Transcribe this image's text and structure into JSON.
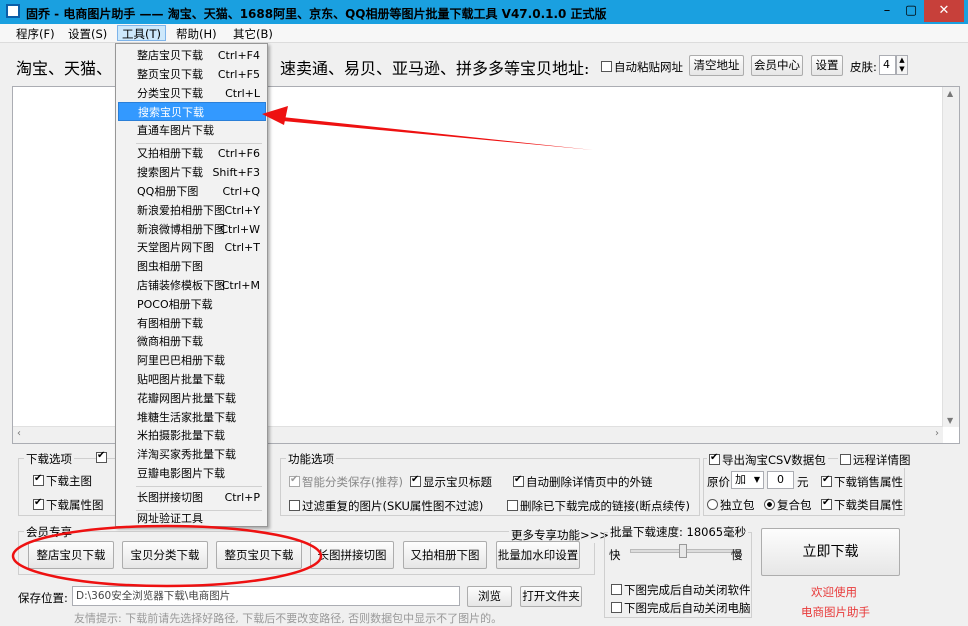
{
  "window": {
    "title": "固乔 - 电商图片助手 —— 淘宝、天猫、1688阿里、京东、QQ相册等图片批量下载工具 V47.0.1.0 正式版",
    "minimize": "–",
    "maximize": "▢",
    "close": "✕"
  },
  "menu": [
    "程序(F)",
    "设置(S)",
    "工具(T)",
    "帮助(H)",
    "其它(B)"
  ],
  "address": {
    "label_left": "淘宝、天猫、",
    "label_right": "速卖通、易贝、亚马逊、拼多多等宝贝地址:",
    "auto_paste": "自动粘贴网址",
    "clear": "清空地址",
    "member_center": "会员中心",
    "settings": "设置",
    "skin_label": "皮肤:",
    "skin_value": "4"
  },
  "dropdown": [
    {
      "label": "整店宝贝下载",
      "shortcut": "Ctrl+F4"
    },
    {
      "label": "整页宝贝下载",
      "shortcut": "Ctrl+F5"
    },
    {
      "label": "分类宝贝下载",
      "shortcut": "Ctrl+L"
    },
    {
      "label": "搜索宝贝下载",
      "shortcut": ""
    },
    {
      "label": "直通车图片下载",
      "shortcut": ""
    },
    {
      "label": "又拍相册下载",
      "shortcut": "Ctrl+F6"
    },
    {
      "label": "搜索图片下载",
      "shortcut": "Shift+F3"
    },
    {
      "label": "QQ相册下图",
      "shortcut": "Ctrl+Q"
    },
    {
      "label": "新浪爱拍相册下图",
      "shortcut": "Ctrl+Y"
    },
    {
      "label": "新浪微博相册下图",
      "shortcut": "Ctrl+W"
    },
    {
      "label": "天堂图片网下图",
      "shortcut": "Ctrl+T"
    },
    {
      "label": "图虫相册下图",
      "shortcut": ""
    },
    {
      "label": "店铺装修模板下图",
      "shortcut": "Ctrl+M"
    },
    {
      "label": "POCO相册下载",
      "shortcut": ""
    },
    {
      "label": "有图相册下载",
      "shortcut": ""
    },
    {
      "label": "微商相册下载",
      "shortcut": ""
    },
    {
      "label": "阿里巴巴相册下载",
      "shortcut": ""
    },
    {
      "label": "贴吧图片批量下载",
      "shortcut": ""
    },
    {
      "label": "花瓣网图片批量下载",
      "shortcut": ""
    },
    {
      "label": "堆糖生活家批量下载",
      "shortcut": ""
    },
    {
      "label": "米拍摄影批量下载",
      "shortcut": ""
    },
    {
      "label": "洋淘买家秀批量下载",
      "shortcut": ""
    },
    {
      "label": "豆瓣电影图片下载",
      "shortcut": ""
    },
    {
      "label": "长图拼接切图",
      "shortcut": "Ctrl+P"
    },
    {
      "label": "网址验证工具",
      "shortcut": ""
    }
  ],
  "download_options": {
    "title": "下载选项",
    "main_image": "下载主图",
    "attr_image": "下载属性图"
  },
  "function_options": {
    "title": "功能选项",
    "smart_save": "智能分类保存(推荐)",
    "show_title": "显示宝贝标题",
    "auto_delete": "自动删除详情页中的外链",
    "filter_dup": "过滤重复的图片(SKU属性图不过滤)",
    "delete_done": "删除已下载完成的链接(断点续传)"
  },
  "csv": {
    "export": "导出淘宝CSV数据包",
    "remote": "远程详情图",
    "price_label": "原价",
    "price_op": "加",
    "price_value": "0",
    "unit": "元",
    "sales_attr": "下载销售属性",
    "single": "独立包",
    "combined": "复合包",
    "category_attr": "下载类目属性"
  },
  "member": {
    "title": "会员专享",
    "more": "更多专享功能>>>",
    "buttons": [
      "整店宝贝下载",
      "宝贝分类下载",
      "整页宝贝下载",
      "长图拼接切图",
      "又拍相册下图",
      "批量加水印设置"
    ]
  },
  "speed": {
    "title": "批量下载速度: 18065毫秒",
    "fast": "快",
    "slow": "慢",
    "close_software": "下图完成后自动关闭软件",
    "close_computer": "下图完成后自动关闭电脑"
  },
  "download_now": "立即下载",
  "welcome1": "欢迎使用",
  "welcome2": "电商图片助手",
  "save": {
    "label": "保存位置:",
    "path": "D:\\360安全浏览器下载\\电商图片",
    "browse": "浏览",
    "open_folder": "打开文件夹",
    "tip": "友情提示: 下载前请先选择好路径, 下载后不要改变路径, 否则数据包中显示不了图片的。"
  },
  "colors": {
    "title_bar": "#1aa0e0",
    "highlight": "#3399ff",
    "annotation_red": "#ee1111",
    "welcome_text": "#e83a3a"
  }
}
